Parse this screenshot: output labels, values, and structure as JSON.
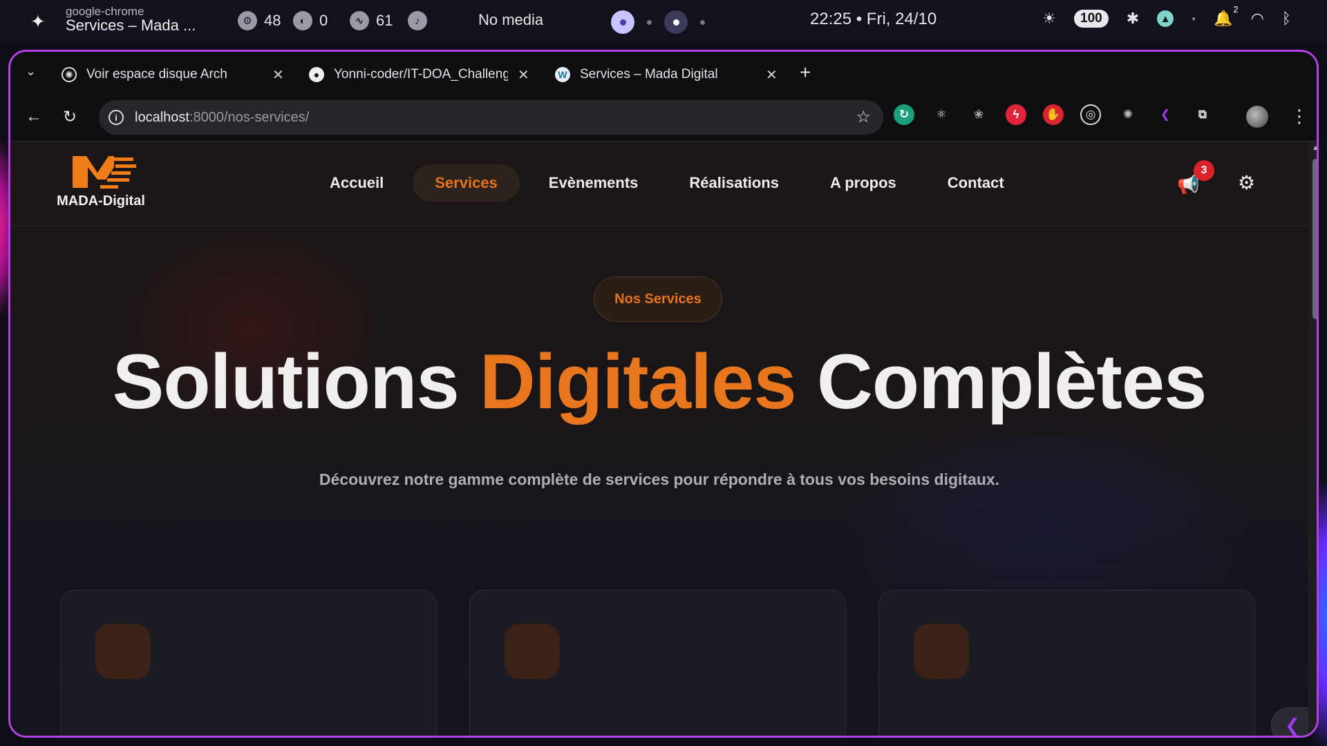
{
  "system_bar": {
    "window_class": "google-chrome",
    "window_title": "Services – Mada ...",
    "cpu_value": "48",
    "gpu_value": "0",
    "ram_value": "61",
    "media_label": "No media",
    "clock": "22:25 • Fri, 24/10",
    "battery": "100",
    "notification_count": "2"
  },
  "tabs": [
    {
      "label": "Voir espace disque Arch",
      "icon": "openai-icon"
    },
    {
      "label": "Yonni-coder/IT-DOA_Challenge",
      "icon": "github-icon"
    },
    {
      "label": "Services – Mada Digital",
      "icon": "wordpress-icon"
    }
  ],
  "omnibox": {
    "host": "localhost",
    "path": ":8000/nos-services/"
  },
  "site": {
    "logo_text": "MADA-Digital",
    "nav": [
      "Accueil",
      "Services",
      "Evènements",
      "Réalisations",
      "A propos",
      "Contact"
    ],
    "active_nav": "Services",
    "announcement_badge": "3",
    "hero_pill": "Nos Services",
    "hero_title_part1": "Solutions ",
    "hero_title_accent": "Digitales",
    "hero_title_part2": " Complètes",
    "hero_subtitle": "Découvrez notre gamme complète de services pour répondre à tous vos besoins digitaux."
  },
  "colors": {
    "accent": "#e8761e",
    "window_border": "#b341e6",
    "badge": "#d8232a"
  }
}
